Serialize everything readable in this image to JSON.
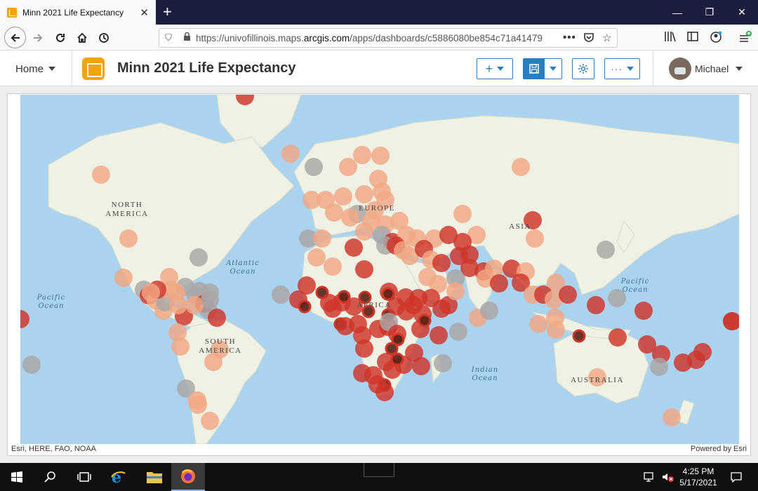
{
  "browser": {
    "tab_title": "Minn 2021 Life Expectancy",
    "new_tab_label": "+",
    "url_prefix": "https://univofillinois.maps.",
    "url_domain": "arcgis.com",
    "url_suffix": "/apps/dashboards/c5886080be854c71a41479",
    "url_more": "•••"
  },
  "app": {
    "home_label": "Home",
    "title": "Minn 2021 Life Expectancy",
    "user_name": "Michael",
    "add_label": "+",
    "more_label": "···"
  },
  "map": {
    "labels": {
      "north_america": "NORTH\nAMERICA",
      "south_america": "SOUTH\nAMERICA",
      "europe": "EUROPE",
      "asia": "ASIA",
      "africa": "AFRICA",
      "australia": "AUSTRALIA",
      "atlantic": "Atlantic\nOcean",
      "pacific_w": "Pacific\nOcean",
      "pacific_e": "Pacific\nOcean",
      "indian": "Indian\nOcean"
    },
    "attribution": "Esri, HERE, FAO, NOAA",
    "powered_by": "Powered by Esri",
    "colors": {
      "ocean": "#a9d3ef",
      "land": "#eef1e4",
      "dark": "#5c1f14",
      "red": "#d0352a",
      "light": "#f1a784",
      "grey": "#a9a6a6"
    }
  },
  "taskbar": {
    "time": "4:25 PM",
    "date": "5/17/2021"
  }
}
